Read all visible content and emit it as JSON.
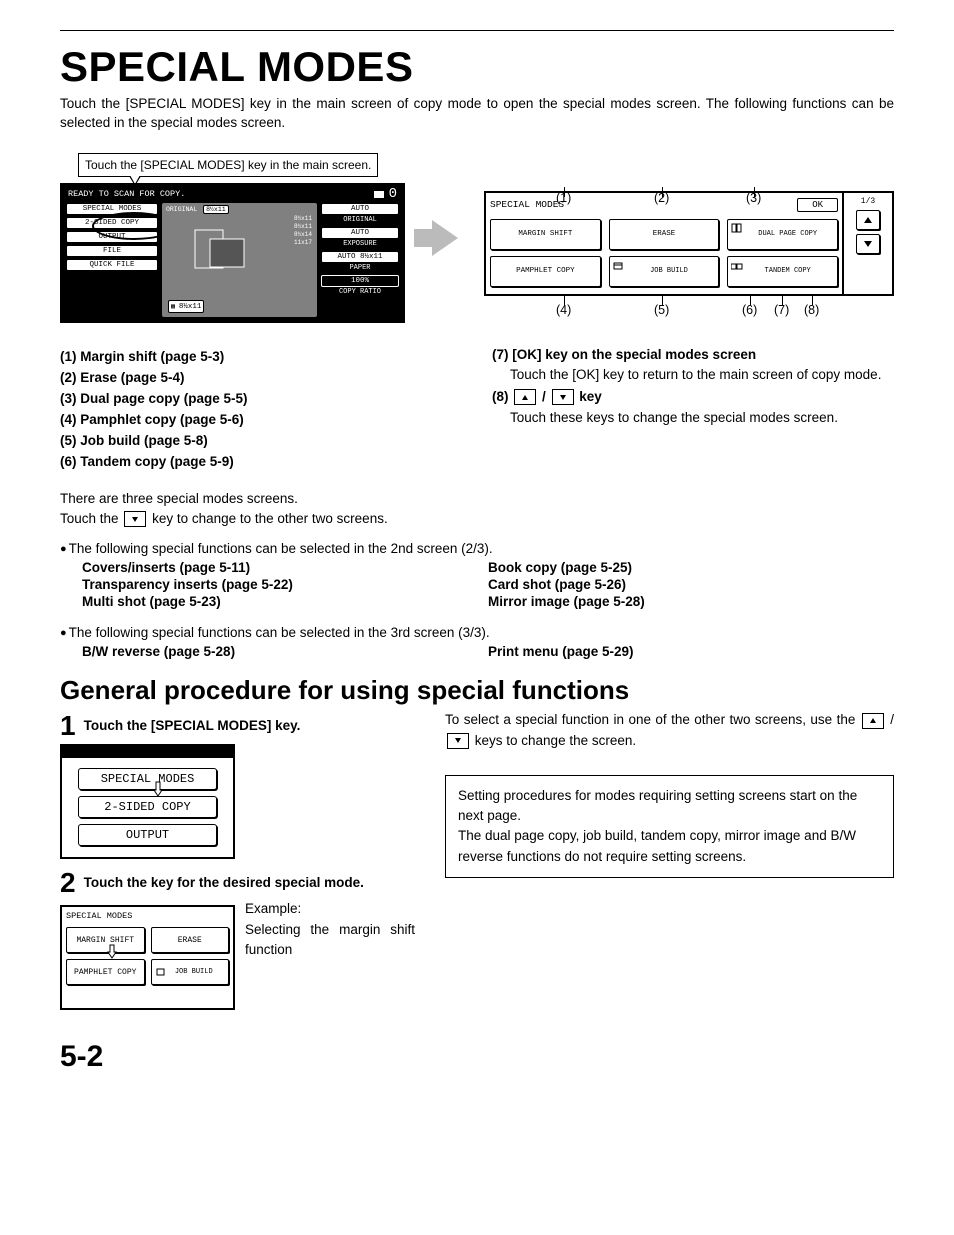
{
  "heading": "SPECIAL MODES",
  "intro": "Touch the [SPECIAL MODES] key in the main screen of copy mode to open the special modes screen. The following functions can be selected in the special modes screen.",
  "tip": "Touch the [SPECIAL MODES] key in the main screen.",
  "copy_screen": {
    "scan_label": "READY TO SCAN FOR COPY.",
    "count": "0",
    "left_buttons": [
      "SPECIAL MODES",
      "2-SIDED COPY",
      "OUTPUT",
      "FILE",
      "QUICK FILE"
    ],
    "orig_label": "ORIGINAL",
    "orig_size": "8½x11",
    "right_items": [
      {
        "label": "AUTO",
        "sub": "ORIGINAL"
      },
      {
        "label": "AUTO",
        "sub": "EXPOSURE"
      },
      {
        "label": "AUTO 8½x11",
        "sub": "PAPER"
      },
      {
        "label": "100%",
        "sub": "COPY RATIO"
      }
    ],
    "mid_size": "8½x11",
    "mid_list": [
      "8½x11",
      "8½x11",
      "8½x14",
      "11x17"
    ]
  },
  "callouts_top": {
    "1": "(1)",
    "2": "(2)",
    "3": "(3)"
  },
  "callouts_bottom": {
    "4": "(4)",
    "5": "(5)",
    "6": "(6)",
    "7": "(7)",
    "8": "(8)"
  },
  "sm_panel": {
    "title": "SPECIAL MODES",
    "ok": "OK",
    "page": "1/3",
    "cells": [
      "MARGIN SHIFT",
      "ERASE",
      "DUAL PAGE COPY",
      "PAMPHLET COPY",
      "JOB BUILD",
      "TANDEM COPY"
    ]
  },
  "list_left": [
    "(1)  Margin shift (page 5-3)",
    "(2)  Erase (page 5-4)",
    "(3)  Dual page copy (page 5-5)",
    "(4)  Pamphlet copy (page 5-6)",
    "(5)  Job build (page 5-8)",
    "(6)  Tandem copy (page 5-9)"
  ],
  "list_right": {
    "h7": "(7) [OK] key on the special modes screen",
    "p7": "Touch the [OK] key to return to the main screen of copy mode.",
    "h8_pre": "(8)  ",
    "h8_suf": "  key",
    "p8": "Touch these keys to change the special modes screen."
  },
  "mid_text1": "There are three special modes screens.",
  "mid_text2_pre": "Touch the ",
  "mid_text2_suf": " key to change to the other two screens.",
  "bullet2": "The following special functions can be selected in the 2nd screen (2/3).",
  "screen2_left": [
    "Covers/inserts (page 5-11)",
    "Transparency inserts (page 5-22)",
    "Multi shot (page 5-23)"
  ],
  "screen2_right": [
    "Book copy (page 5-25)",
    "Card shot (page 5-26)",
    "Mirror image (page 5-28)"
  ],
  "bullet3": "The following special functions can be selected in the 3rd screen (3/3).",
  "screen3_left": [
    "B/W reverse (page 5-28)"
  ],
  "screen3_right": [
    "Print menu (page 5-29)"
  ],
  "h2": "General procedure for using special functions",
  "step1": {
    "num": "1",
    "text": "Touch the [SPECIAL MODES] key."
  },
  "mini1_buttons": [
    "SPECIAL MODES",
    "2-SIDED COPY",
    "OUTPUT"
  ],
  "right_sel_pre": "To select a special function in one of the other two screens, use the ",
  "right_sel_suf": " keys to change the screen.",
  "info_box": "Setting procedures for modes requiring setting screens start on the next page.\nThe dual page copy, job build, tandem copy, mirror image and B/W reverse functions do not require setting screens.",
  "step2": {
    "num": "2",
    "text": "Touch the key for the desired special mode."
  },
  "example_label": "Example:",
  "example_text": "Selecting the margin shift function",
  "mini2": {
    "title": "SPECIAL MODES",
    "cells": [
      "MARGIN SHIFT",
      "ERASE",
      "PAMPHLET COPY",
      "JOB BUILD"
    ]
  },
  "page_number": "5-2"
}
